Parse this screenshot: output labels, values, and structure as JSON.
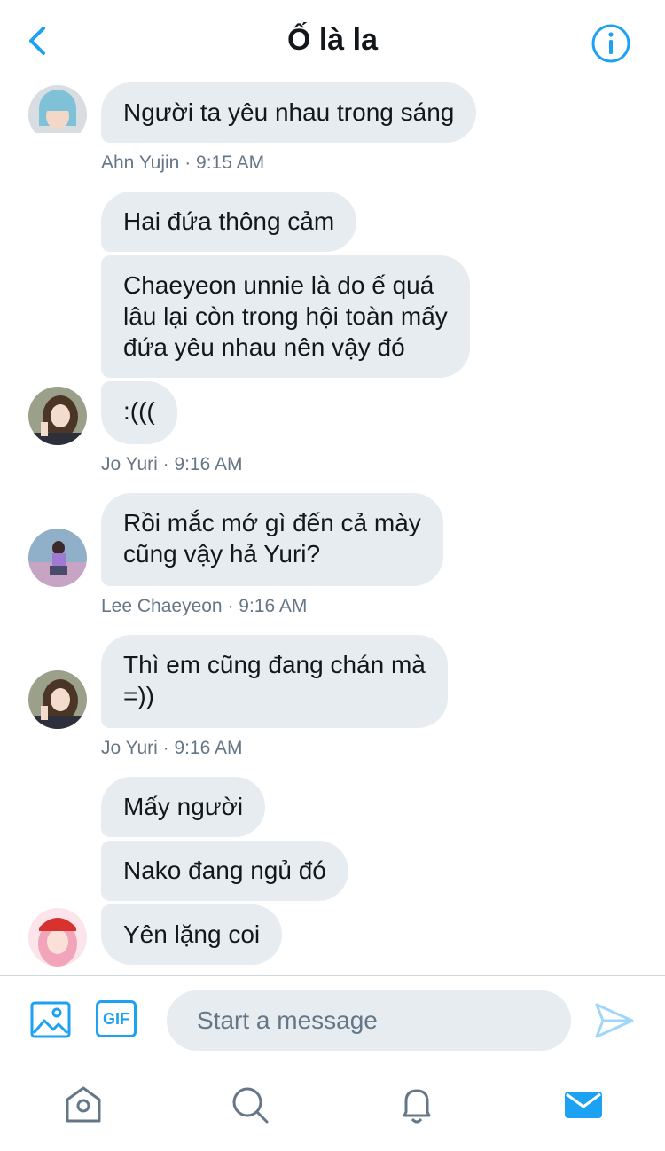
{
  "header": {
    "title": "Ố là la",
    "back_icon": "chevron-left-icon",
    "info_icon": "info-icon"
  },
  "messages": [
    {
      "text": "Người ta yêu nhau trong sáng"
    },
    {
      "text": "Hai đứa thông cảm"
    },
    {
      "text": "Chaeyeon unnie là do ế quá\nlâu lại còn trong hội toàn mấy\nđứa yêu nhau nên vậy đó"
    },
    {
      "text": ":((("
    },
    {
      "text": "Rồi mắc mớ gì đến cả mày\ncũng vậy hả Yuri?"
    },
    {
      "text": "Thì em cũng đang chán mà\n=))"
    },
    {
      "text": "Mấy người"
    },
    {
      "text": "Nako đang ngủ đó"
    },
    {
      "text": "Yên lặng coi"
    }
  ],
  "meta": [
    {
      "text": "Ahn Yujin · 9:15 AM"
    },
    {
      "text": "Jo Yuri · 9:16 AM"
    },
    {
      "text": "Lee Chaeyeon · 9:16 AM"
    },
    {
      "text": "Jo Yuri · 9:16 AM"
    }
  ],
  "avatars": [
    {
      "name": "Ahn Yujin"
    },
    {
      "name": "Jo Yuri"
    },
    {
      "name": "Lee Chaeyeon"
    },
    {
      "name": "Jo Yuri"
    },
    {
      "name": "unknown"
    }
  ],
  "composer": {
    "placeholder": "Start a message",
    "gif_label": "GIF",
    "media_icon": "image-icon",
    "send_icon": "send-icon"
  },
  "tabbar": {
    "items": [
      "home-icon",
      "search-icon",
      "notifications-icon",
      "messages-icon"
    ],
    "active": "messages-icon"
  },
  "colors": {
    "accent": "#1da1f2",
    "bubble": "#e6ecf0",
    "meta_text": "#657786"
  }
}
